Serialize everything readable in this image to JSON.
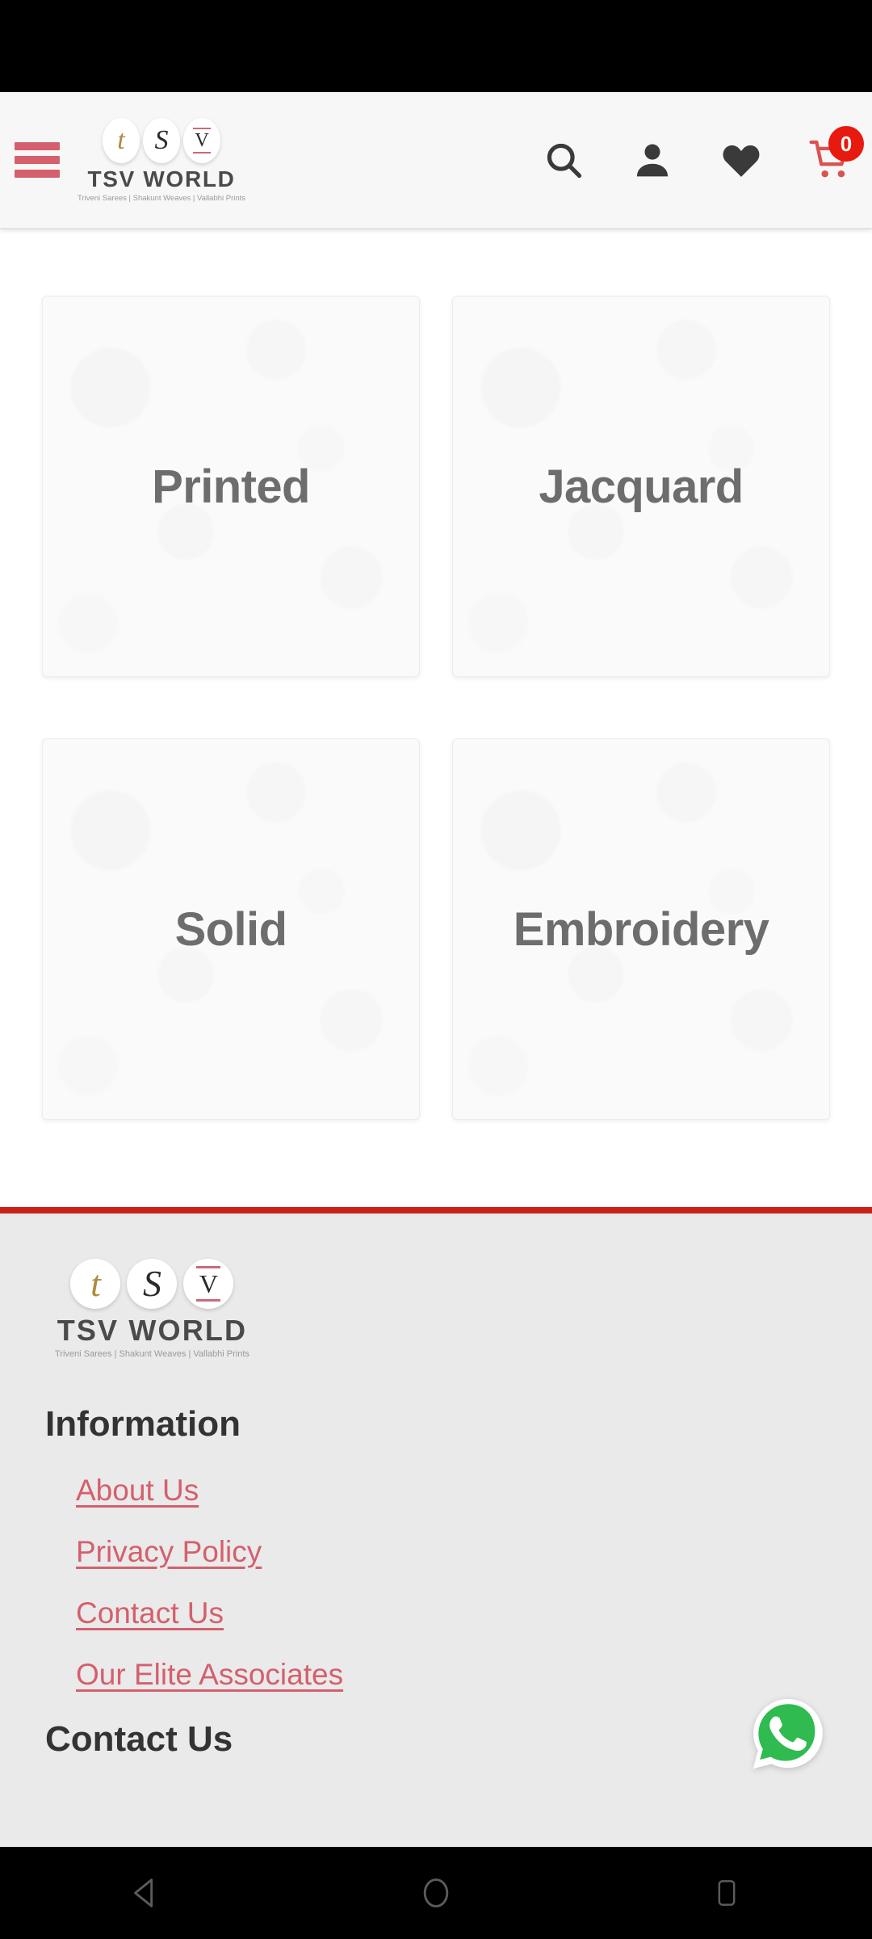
{
  "brand": {
    "wordmark": "TSV WORLD",
    "tagline": "Triveni Sarees | Shakunt Weaves | Vallabhi Prints",
    "glyph_t": "t",
    "glyph_s": "S",
    "glyph_v": "V",
    "accent_red": "#cc2117",
    "accent_pink": "#d4606d",
    "gold": "#b08a3e"
  },
  "header": {
    "menu_label": "Menu",
    "icons": {
      "search": "search-icon",
      "account": "person-icon",
      "wishlist": "heart-icon",
      "cart": "cart-icon"
    },
    "cart_count": "0"
  },
  "categories": [
    {
      "label": "Printed"
    },
    {
      "label": "Jacquard"
    },
    {
      "label": "Solid"
    },
    {
      "label": "Embroidery"
    }
  ],
  "footer": {
    "information_heading": "Information",
    "links": [
      {
        "label": "About Us"
      },
      {
        "label": "Privacy Policy"
      },
      {
        "label": "Contact Us"
      },
      {
        "label": "Our Elite Associates"
      }
    ],
    "contact_heading": "Contact Us"
  },
  "floating": {
    "whatsapp_label": "WhatsApp"
  },
  "navbar": {
    "back": "back-button",
    "home": "home-button",
    "recents": "recents-button"
  }
}
